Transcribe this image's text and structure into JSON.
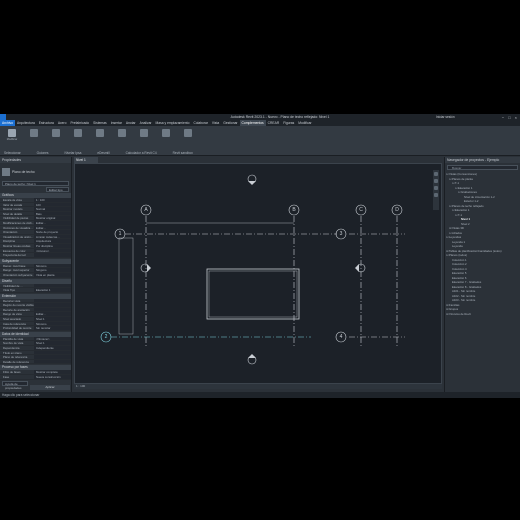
{
  "window": {
    "title": "Autodesk Revit 2023.1 - Nuevo - Plano de techo reflejado: Nivel 1",
    "user": "Iniciar sesión",
    "controls": [
      "−",
      "□",
      "×"
    ]
  },
  "menu": {
    "tabs": [
      "Archivo",
      "Arquitectura",
      "Estructura",
      "Acero",
      "Prefabricado",
      "Sistemas",
      "Insertar",
      "Anotar",
      "Analizar",
      "Masa y emplazamiento",
      "Colaborar",
      "Vista",
      "Gestionar",
      "Complementos",
      "CREAR",
      "Figuras",
      "Modificar"
    ],
    "active_index": 0,
    "selected_index": 13
  },
  "ribbon": {
    "tools": [
      "Modificar",
      "",
      "",
      "",
      "",
      "",
      "",
      "",
      ""
    ],
    "panels": [
      "Seleccionar",
      "Guiones",
      "Nivelar Ipsa",
      "eDesmill",
      "Calculador a Revit C4",
      "Revit sandbox"
    ]
  },
  "properties": {
    "header": "Propiedades",
    "type_name": "Plano de techo",
    "selector": "Plano de techo: Nivel 1",
    "edit_type": "Editar tipo",
    "groups": [
      {
        "name": "Gráficos",
        "rows": [
          {
            "k": "Escala de vista",
            "v": "1 : 100"
          },
          {
            "k": "Valor de escala",
            "v": "100"
          },
          {
            "k": "Mostrar modelo",
            "v": "Normal"
          },
          {
            "k": "Nivel de detalle",
            "v": "Bajo"
          },
          {
            "k": "Visibilidad de piezas",
            "v": "Mostrar original"
          },
          {
            "k": "Modificaciones de visib...",
            "v": "Editar..."
          },
          {
            "k": "Opciones de visualiza...",
            "v": "Editar..."
          },
          {
            "k": "Orientación",
            "v": "Norte de proyecto"
          },
          {
            "k": "Visualización de unión...",
            "v": "Limpiar todas las..."
          },
          {
            "k": "Disciplina",
            "v": "Arquitectura"
          },
          {
            "k": "Mostrar líneas ocultas",
            "v": "Por disciplina"
          },
          {
            "k": "Esquema de color",
            "v": "<ninguno>"
          },
          {
            "k": "Trayectoria del sol",
            "v": ""
          }
        ]
      },
      {
        "name": "Subyacente",
        "rows": [
          {
            "k": "Rango: nivel base",
            "v": "Ninguno"
          },
          {
            "k": "Rango: nivel superior",
            "v": "Ninguno"
          },
          {
            "k": "Orientación subyacente",
            "v": "Vista en planta"
          }
        ]
      },
      {
        "name": "Diseño",
        "rows": [
          {
            "k": "Visibilidad de ...",
            "v": ""
          },
          {
            "k": "Vista Tipo",
            "v": "Elevación 1"
          }
        ]
      },
      {
        "name": "Extensión",
        "rows": [
          {
            "k": "Recortar vista",
            "v": ""
          },
          {
            "k": "Región de recorte visible",
            "v": ""
          },
          {
            "k": "Recorte de anotación",
            "v": ""
          },
          {
            "k": "Rango de vista",
            "v": "Editar..."
          },
          {
            "k": "Nivel asociado",
            "v": "Nivel 1"
          },
          {
            "k": "Caja de referencia",
            "v": "Ninguno"
          },
          {
            "k": "Profundidad de recorte",
            "v": "Sin recortar"
          }
        ]
      },
      {
        "name": "Datos de identidad",
        "rows": [
          {
            "k": "Plantilla de vista",
            "v": "<Ninguno>"
          },
          {
            "k": "Nombre de vista",
            "v": "Nivel 1"
          },
          {
            "k": "Dependencia",
            "v": "Independiente"
          },
          {
            "k": "Título en plano",
            "v": ""
          },
          {
            "k": "Plano de referencia",
            "v": ""
          },
          {
            "k": "Detalle de referencia",
            "v": ""
          }
        ]
      },
      {
        "name": "Proceso por fases",
        "rows": [
          {
            "k": "Filtro de fases",
            "v": "Mostrar completa"
          },
          {
            "k": "Fase",
            "v": "Nueva construcción"
          }
        ]
      }
    ],
    "help": "Ayuda de propiedades",
    "apply": "Aplicar"
  },
  "view": {
    "tab": "Nivel 1",
    "scale": "1 : 100",
    "grid_labels": {
      "vertical": [
        "A",
        "B",
        "C",
        "D"
      ],
      "horizontal": [
        "1",
        "2",
        "3",
        "4"
      ]
    }
  },
  "status": {
    "text": "Haga clic para seleccionar"
  },
  "browser": {
    "header": "Navegador de proyectos - Ejemplo",
    "search_placeholder": "Buscar",
    "tree": [
      {
        "t": "Vistas (Convenciones)",
        "d": 0,
        "tw": "⊟"
      },
      {
        "t": "Planos de planta",
        "d": 1,
        "tw": "⊟"
      },
      {
        "t": "T-1",
        "d": 2,
        "tw": "⊟"
      },
      {
        "t": "Elevación 1",
        "d": 3,
        "tw": "⊟"
      },
      {
        "t": "Grabaciones",
        "d": 4,
        "tw": "⊟"
      },
      {
        "t": "Nivel de cimentación 1-2",
        "d": 5,
        "tw": ""
      },
      {
        "t": "Exterior 1-2",
        "d": 5,
        "tw": ""
      },
      {
        "t": "Planos de techo reflejado",
        "d": 1,
        "tw": "⊟"
      },
      {
        "t": "Elevación 1",
        "d": 2,
        "tw": "⊟"
      },
      {
        "t": "T-1",
        "d": 3,
        "tw": "⊟"
      },
      {
        "t": "Nivel 1",
        "d": 4,
        "tw": "",
        "b": true
      },
      {
        "t": "Nivel 2",
        "d": 4,
        "tw": ""
      },
      {
        "t": "Vistas 3D",
        "d": 1,
        "tw": "⊞"
      },
      {
        "t": "Alzados",
        "d": 1,
        "tw": "⊟"
      },
      {
        "t": "Leyendas",
        "d": 0,
        "tw": "⊟"
      },
      {
        "t": "Leyenda 1",
        "d": 1,
        "tw": ""
      },
      {
        "t": "Leyenda",
        "d": 1,
        "tw": ""
      },
      {
        "t": "Tablas de planificación/Cantidades (todos)",
        "d": 0,
        "tw": "⊞"
      },
      {
        "t": "Planos (todos)",
        "d": 0,
        "tw": "⊟"
      },
      {
        "t": "Colección 1",
        "d": 1,
        "tw": ""
      },
      {
        "t": "Colección 2",
        "d": 1,
        "tw": ""
      },
      {
        "t": "Colección 4",
        "d": 1,
        "tw": ""
      },
      {
        "t": "Elevación 5",
        "d": 1,
        "tw": ""
      },
      {
        "t": "Elevación 6",
        "d": 1,
        "tw": ""
      },
      {
        "t": "Elevación 7 - Grabados",
        "d": 1,
        "tw": ""
      },
      {
        "t": "Elevación 8 - Grabados",
        "d": 1,
        "tw": ""
      },
      {
        "t": "A101 - Sin nombre",
        "d": 1,
        "tw": ""
      },
      {
        "t": "A102 - Sin nombre",
        "d": 1,
        "tw": ""
      },
      {
        "t": "A103 - Sin nombre",
        "d": 1,
        "tw": ""
      },
      {
        "t": "Familias",
        "d": 0,
        "tw": "⊞"
      },
      {
        "t": "Grupos",
        "d": 0,
        "tw": "⊞"
      },
      {
        "t": "Vínculos de Revit",
        "d": 0,
        "tw": "⊞"
      }
    ]
  }
}
